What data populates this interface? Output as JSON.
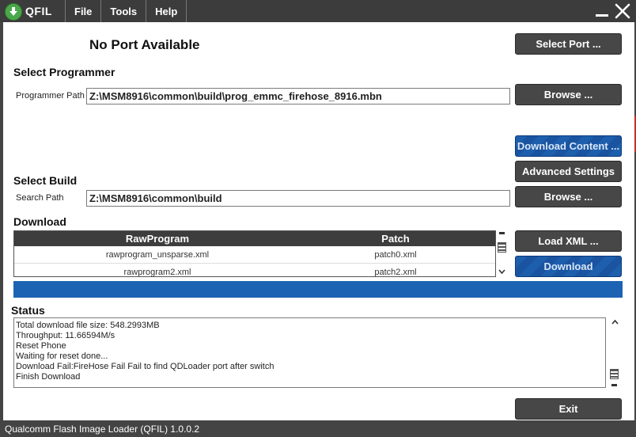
{
  "app": {
    "name": "QFIL"
  },
  "menu": [
    "File",
    "Tools",
    "Help"
  ],
  "port": {
    "title": "No Port Available",
    "select_label": "Select Port ..."
  },
  "programmer": {
    "title": "Select Programmer",
    "path_label": "Programmer Path",
    "path_value": "Z:\\MSM8916\\common\\build\\prog_emmc_firehose_8916.mbn",
    "browse_label": "Browse ..."
  },
  "buttons": {
    "download_content": "Download Content ...",
    "advanced_settings": "Advanced Settings",
    "load_xml": "Load XML ...",
    "download": "Download",
    "exit": "Exit"
  },
  "build": {
    "title": "Select Build",
    "path_label": "Search Path",
    "path_value": "Z:\\MSM8916\\common\\build",
    "browse_label": "Browse ..."
  },
  "download": {
    "title": "Download",
    "columns": [
      "RawProgram",
      "Patch"
    ],
    "rows": [
      {
        "raw": "rawprogram_unsparse.xml",
        "patch": "patch0.xml"
      },
      {
        "raw": "rawprogram2.xml",
        "patch": "patch2.xml"
      }
    ]
  },
  "progress": {
    "fraction": 1.0
  },
  "status": {
    "title": "Status",
    "lines": [
      "Total download file size: 548.2993MB",
      "Throughput: 11.66594M/s",
      "Reset Phone",
      "Waiting for reset done...",
      "Download Fail:FireHose Fail Fail to find QDLoader port after switch",
      "Finish Download"
    ]
  },
  "statusbar": {
    "text": "Qualcomm Flash Image Loader (QFIL)   1.0.0.2"
  },
  "colors": {
    "accent": "#1d63b3",
    "titlebar": "#3c3c3c",
    "button": "#474747"
  }
}
